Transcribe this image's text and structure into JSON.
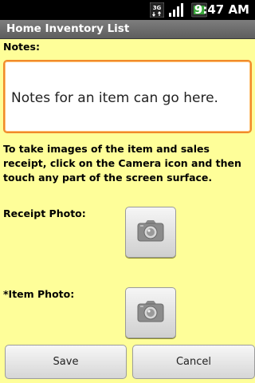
{
  "status_bar": {
    "time": "9:47",
    "ampm": "AM",
    "network_type": "3G",
    "icons": [
      "3g-icon",
      "signal-icon",
      "battery-icon"
    ]
  },
  "app": {
    "title": "Home Inventory List"
  },
  "form": {
    "notes_label": "Notes:",
    "notes_value": "Notes for an item can go here.",
    "instructions": "To take images of the item and sales receipt, click on the Camera icon and then touch any part of the screen surface.",
    "receipt_label": "Receipt Photo:",
    "item_label": "*Item Photo:"
  },
  "buttons": {
    "save": "Save",
    "cancel": "Cancel"
  },
  "colors": {
    "background": "#fefe99",
    "focus_border": "#f08a2a",
    "title_bar": "#6b6b6b"
  }
}
